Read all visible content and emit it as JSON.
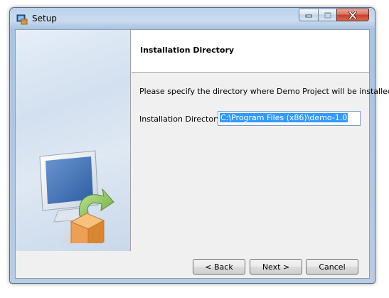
{
  "window": {
    "title": "Setup"
  },
  "header": {
    "title": "Installation Directory"
  },
  "main": {
    "description": "Please specify the directory where Demo Project will be installed.",
    "directory_label": "Installation Directory",
    "directory_value": "C:\\Program Files (x86)\\demo-1.0"
  },
  "buttons": {
    "back": "< Back",
    "next": "Next >",
    "cancel": "Cancel"
  },
  "colors": {
    "selection": "#3399ff",
    "close_button": "#c4402a"
  },
  "icons": {
    "app": "setup-app-icon",
    "minimize": "minimize-icon",
    "maximize": "maximize-icon",
    "close": "close-icon",
    "sidebar_graphic": "monitor-package-install-icon"
  }
}
